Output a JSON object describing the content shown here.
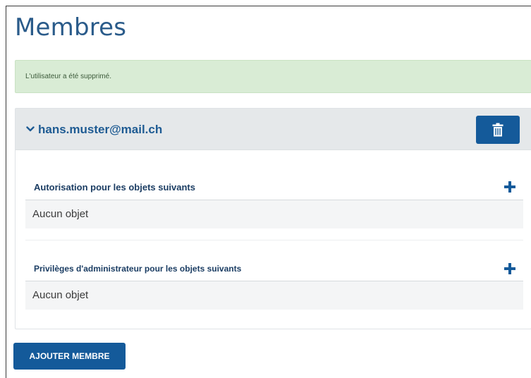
{
  "page": {
    "title": "Membres"
  },
  "alert": {
    "message": "L'utilisateur a été supprimé."
  },
  "member": {
    "email": "hans.muster@mail.ch",
    "delete_icon": "trash-icon",
    "expand_icon": "chevron-down-icon",
    "sections": [
      {
        "title": "Autorisation pour les objets suivants",
        "empty_text": "Aucun objet",
        "add_icon": "plus-icon"
      },
      {
        "title": "Privilèges d'administrateur pour les objets suivants",
        "empty_text": "Aucun objet",
        "add_icon": "plus-icon"
      }
    ]
  },
  "actions": {
    "add_member_label": "AJOUTER MEMBRE"
  },
  "colors": {
    "primary": "#145a9a",
    "title": "#2a5b8a",
    "alert_bg": "#d9ecd5",
    "header_bg": "#e5e8ea"
  }
}
